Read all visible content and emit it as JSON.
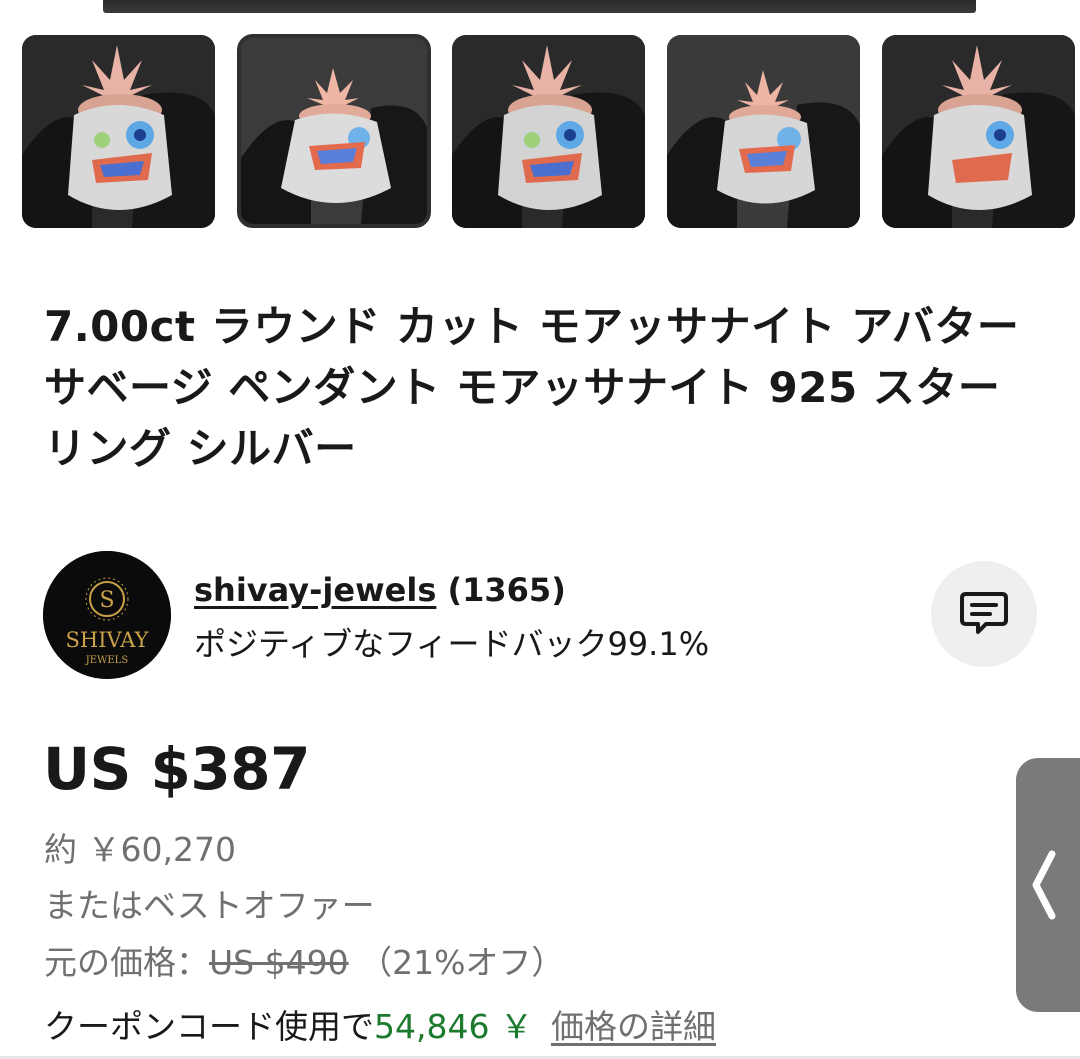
{
  "gallery": {
    "thumbnails": [
      {
        "alt": "thumbnail-1",
        "selected": false
      },
      {
        "alt": "thumbnail-2",
        "selected": true
      },
      {
        "alt": "thumbnail-3",
        "selected": false
      },
      {
        "alt": "thumbnail-4",
        "selected": false
      },
      {
        "alt": "thumbnail-5",
        "selected": false
      }
    ]
  },
  "listing": {
    "title": "7.00ct ラウンド カット モアッサナイト アバター サベージ ペンダント モアッサナイト 925 スターリング シルバー"
  },
  "seller": {
    "name": "shivay-jewels",
    "rating_count": "(1365)",
    "feedback": "ポジティブなフィードバック99.1%",
    "avatar_logo_letter": "S",
    "avatar_logo_name": "SHIVAY",
    "avatar_logo_sub": "JEWELS",
    "message_icon": "message-icon"
  },
  "pricing": {
    "price": "US $387",
    "approx": "約 ￥60,270",
    "best_offer": "またはベストオファー",
    "original_label": "元の価格：",
    "original_price": "US $490",
    "discount": "（21%オフ）",
    "coupon_prefix": "クーポンコード使用で",
    "coupon_price": "54,846 ￥",
    "details_link": "価格の詳細"
  },
  "colors": {
    "accent_green": "#1b7a2e",
    "text": "#191919",
    "muted": "#707070",
    "handle": "#7a7a7a"
  }
}
